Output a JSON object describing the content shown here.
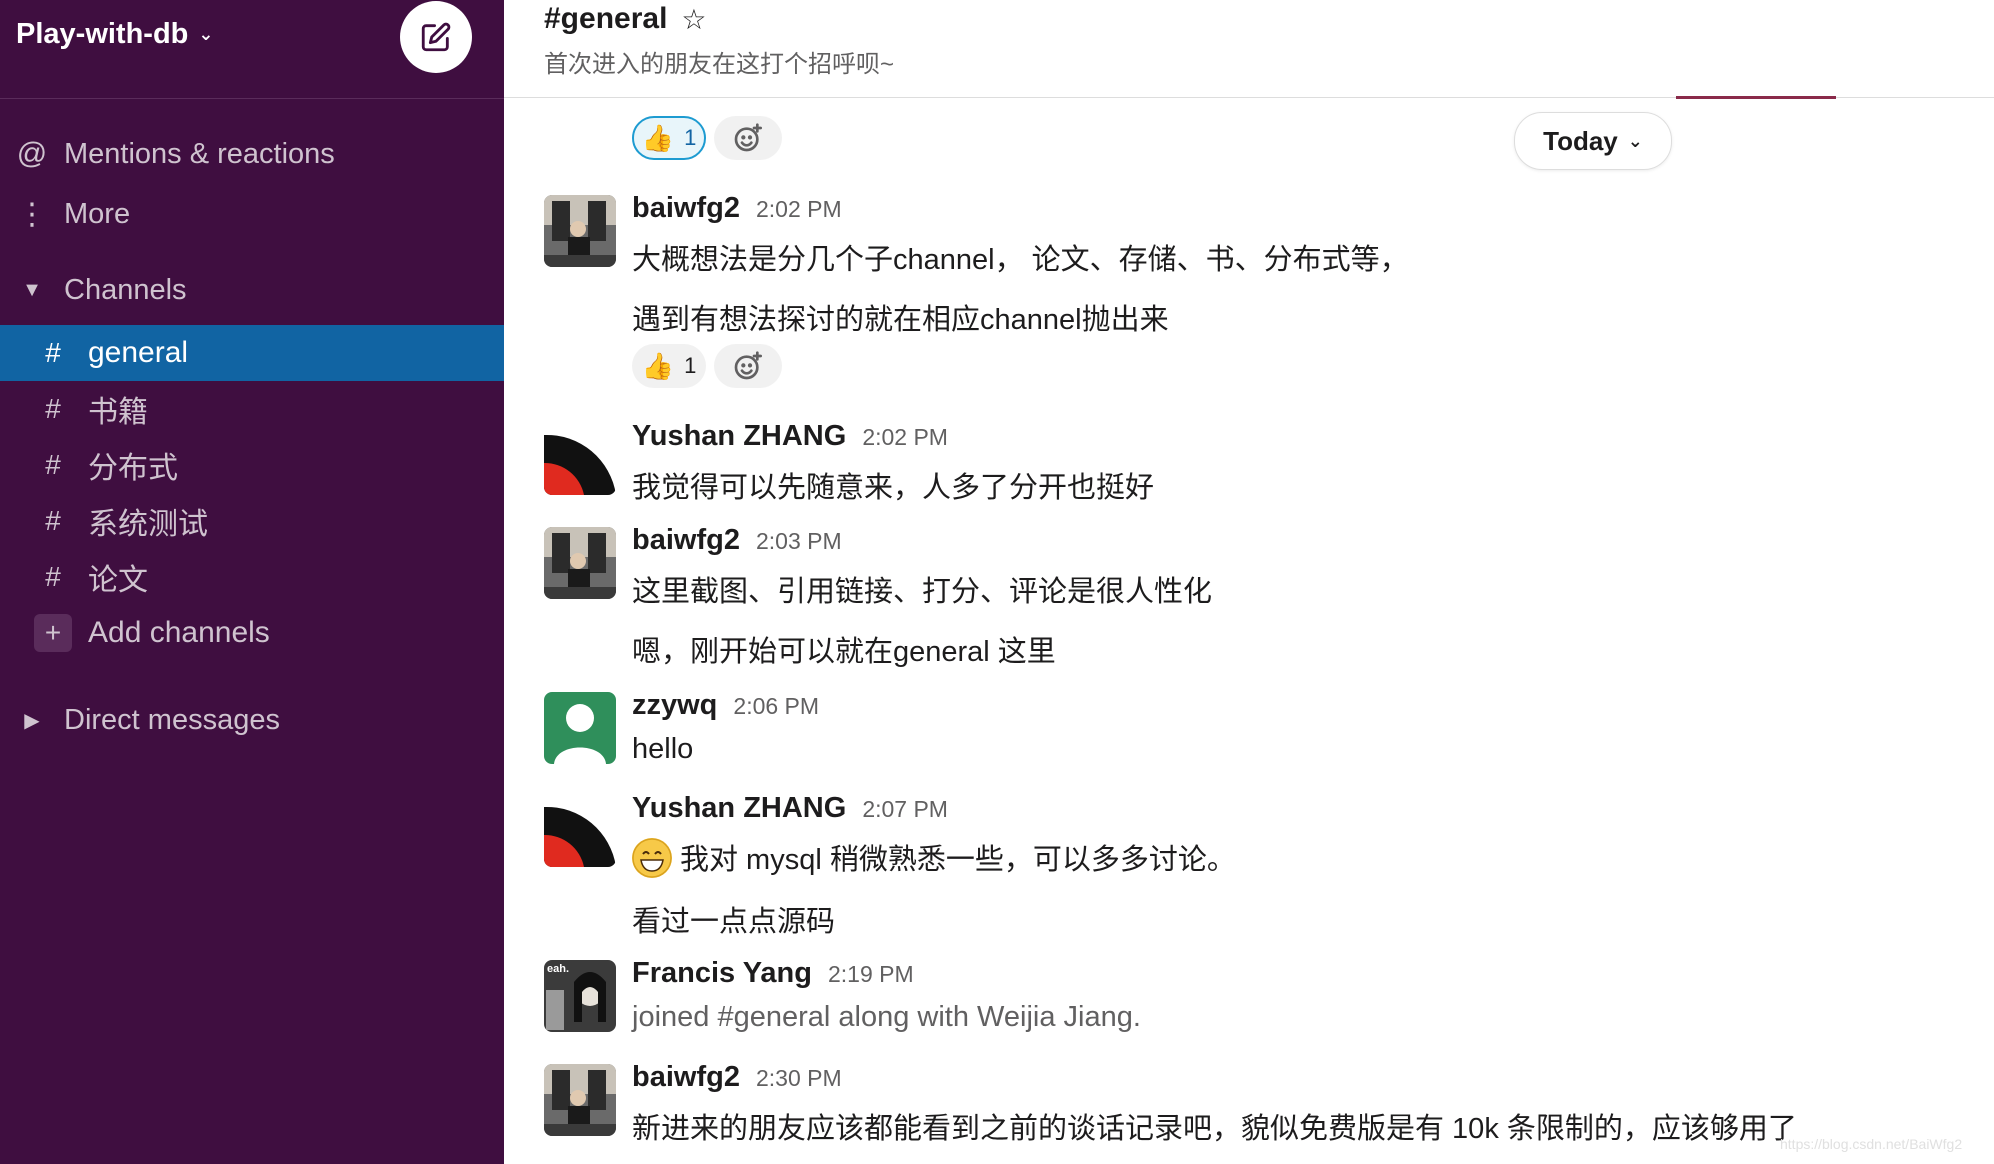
{
  "workspace": {
    "name": "Play-with-db"
  },
  "sidebar": {
    "mentions_label": "Mentions & reactions",
    "more_label": "More",
    "channels_label": "Channels",
    "channels": [
      {
        "name": "general",
        "active": true
      },
      {
        "name": "书籍",
        "active": false
      },
      {
        "name": "分布式",
        "active": false
      },
      {
        "name": "系统测试",
        "active": false
      },
      {
        "name": "论文",
        "active": false
      }
    ],
    "add_channels_label": "Add channels",
    "direct_messages_label": "Direct messages"
  },
  "header": {
    "title": "#general",
    "topic": "首次进入的朋友在这打个招呼呗~"
  },
  "today_label": "Today",
  "top_reaction": {
    "emoji": "👍",
    "count": "1"
  },
  "messages": [
    {
      "author": "baiwfg2",
      "time": "2:02 PM",
      "lines": [
        "大概想法是分几个子channel， 论文、存储、书、分布式等，",
        "遇到有想法探讨的就在相应channel抛出来"
      ],
      "reaction": {
        "emoji": "👍",
        "count": "1"
      }
    },
    {
      "author": "Yushan ZHANG",
      "time": "2:02 PM",
      "lines": [
        "我觉得可以先随意来，人多了分开也挺好"
      ]
    },
    {
      "author": "baiwfg2",
      "time": "2:03 PM",
      "lines": [
        "这里截图、引用链接、打分、评论是很人性化",
        "嗯，刚开始可以就在general 这里"
      ]
    },
    {
      "author": "zzywq",
      "time": "2:06 PM",
      "lines": [
        "hello"
      ]
    },
    {
      "author": "Yushan ZHANG",
      "time": "2:07 PM",
      "lines": [
        "我对 mysql 稍微熟悉一些，可以多多讨论。",
        "看过一点点源码"
      ]
    },
    {
      "author": "Francis Yang",
      "time": "2:19 PM",
      "lines": [
        "joined #general along with Weijia Jiang."
      ],
      "avatar_text": "eah."
    },
    {
      "author": "baiwfg2",
      "time": "2:30 PM",
      "lines": [
        "新进来的朋友应该都能看到之前的谈话记录吧，貌似免费版是有 10k 条限制的，应该够用了"
      ]
    }
  ],
  "watermark": "https://blog.csdn.net/BaiWfg2",
  "colors": {
    "sidebar_bg": "#3f0e40",
    "active_channel": "#1164a3",
    "link_blue": "#1264a3"
  }
}
